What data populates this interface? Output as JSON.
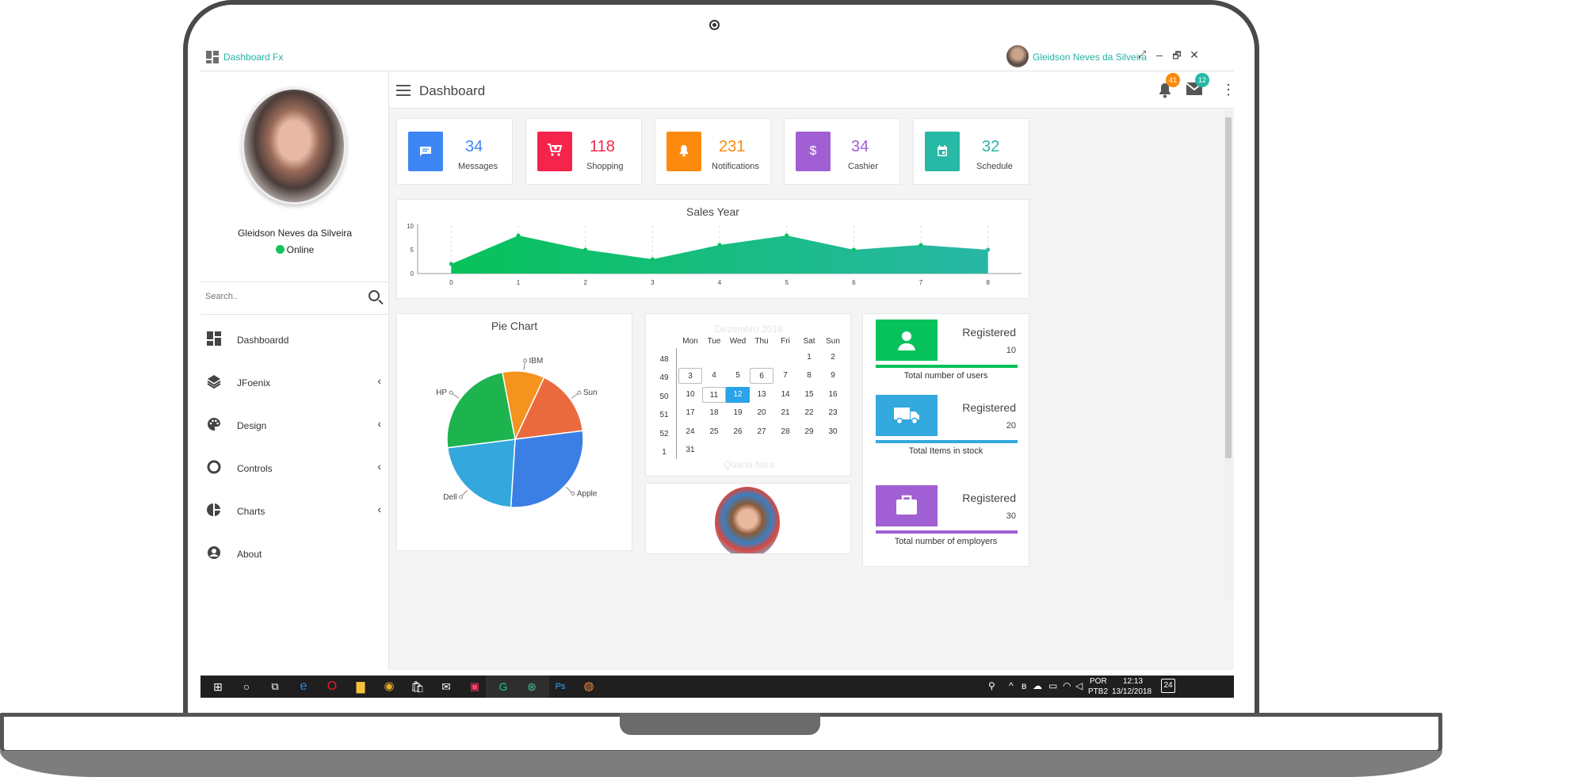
{
  "app": {
    "title": "Dashboard Fx",
    "user": "Gleidson Neves da Silveira"
  },
  "window_buttons": [
    "⤢",
    "–",
    "🗗",
    "✕"
  ],
  "sidebar": {
    "name": "Gleidson Neves da Silveira",
    "status": "Online",
    "search_placeholder": "Search..",
    "items": [
      {
        "label": "Dashboardd",
        "icon": "dashboard-icon",
        "has_children": false
      },
      {
        "label": "JFoenix",
        "icon": "layers-icon",
        "has_children": true
      },
      {
        "label": "Design",
        "icon": "palette-icon",
        "has_children": true
      },
      {
        "label": "Controls",
        "icon": "circle-icon",
        "has_children": true
      },
      {
        "label": "Charts",
        "icon": "pie-chart-icon",
        "has_children": true
      },
      {
        "label": "About",
        "icon": "account-circle-icon",
        "has_children": false
      }
    ]
  },
  "topbar": {
    "title": "Dashboard",
    "notifications_count": "41",
    "messages_count": "12"
  },
  "stats": [
    {
      "value": "34",
      "label": "Messages",
      "icon": "message-icon",
      "color": "#3e86f5"
    },
    {
      "value": "118",
      "label": "Shopping",
      "icon": "cart-plus-icon",
      "color": "#f5244a"
    },
    {
      "value": "231",
      "label": "Notifications",
      "icon": "bell-icon",
      "color": "#fb8a0d"
    },
    {
      "value": "34",
      "label": "Cashier",
      "icon": "dollar-icon",
      "color": "#a05fd2"
    },
    {
      "value": "32",
      "label": "Schedule",
      "icon": "calendar-icon",
      "color": "#27b8a6"
    }
  ],
  "chart_data": [
    {
      "type": "area",
      "title": "Sales Year",
      "x": [
        0,
        1,
        2,
        3,
        4,
        5,
        6,
        7,
        8
      ],
      "y": [
        2,
        8,
        5,
        3,
        6,
        8,
        5,
        6,
        5
      ],
      "xlim": [
        -0.5,
        8.5
      ],
      "ylim": [
        0,
        10
      ],
      "yticks": [
        0,
        5,
        10
      ],
      "color": "#07c25a",
      "color_end": "#28b7a6"
    },
    {
      "type": "pie",
      "title": "Pie Chart",
      "slices": [
        {
          "label": "IBM",
          "value": 10,
          "color": "#f5931f"
        },
        {
          "label": "Sun",
          "value": 16,
          "color": "#ea6a3e"
        },
        {
          "label": "Apple",
          "value": 28,
          "color": "#3b7ee4"
        },
        {
          "label": "Dell",
          "value": 22,
          "color": "#34a8dc"
        },
        {
          "label": "HP",
          "value": 24,
          "color": "#1db34e"
        }
      ]
    }
  ],
  "calendar": {
    "month": "Dezembro 2018",
    "weekday": "Quarta-feira",
    "days_header": [
      "Mon",
      "Tue",
      "Wed",
      "Thu",
      "Fri",
      "Sat",
      "Sun"
    ],
    "weeks": [
      {
        "wk": "48",
        "days": [
          "",
          "",
          "",
          "",
          "1",
          "2"
        ]
      },
      {
        "wk": "49",
        "days": [
          "3",
          "4",
          "5",
          "6",
          "7",
          "8",
          "9"
        ]
      },
      {
        "wk": "50",
        "days": [
          "10",
          "11",
          "12",
          "13",
          "14",
          "15",
          "16"
        ]
      },
      {
        "wk": "51",
        "days": [
          "17",
          "18",
          "19",
          "20",
          "21",
          "22",
          "23"
        ]
      },
      {
        "wk": "52",
        "days": [
          "24",
          "25",
          "26",
          "27",
          "28",
          "29",
          "30"
        ]
      },
      {
        "wk": "1",
        "days": [
          "31"
        ]
      }
    ],
    "selected": "12",
    "accent": "#2aa3e8"
  },
  "registered": [
    {
      "title": "Registered",
      "value": "10",
      "desc": "Total number of users",
      "color": "#07c25a",
      "icon": "person-icon"
    },
    {
      "title": "Registered",
      "value": "20",
      "desc": "Total Items in stock",
      "color": "#33a9de",
      "icon": "truck-icon"
    },
    {
      "title": "Registered",
      "value": "30",
      "desc": "Total number of employers",
      "color": "#a05fd2",
      "icon": "briefcase-icon"
    }
  ],
  "taskbar": {
    "lang": "POR",
    "layout": "PTB2",
    "time": "12:13",
    "date": "13/12/2018",
    "notif": "24"
  }
}
